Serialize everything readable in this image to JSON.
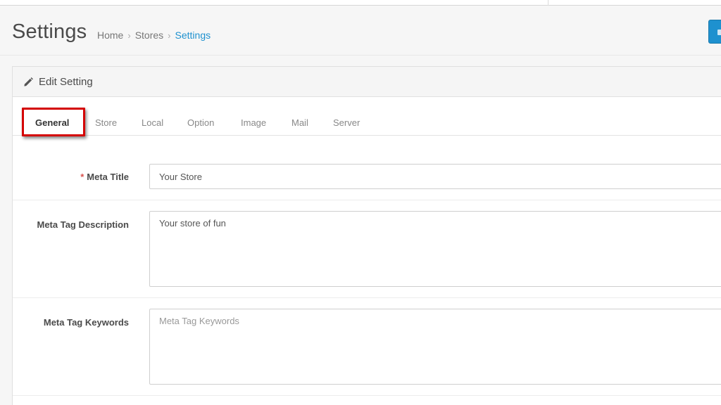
{
  "header": {
    "title": "Settings",
    "breadcrumb": [
      "Home",
      "Stores",
      "Settings"
    ]
  },
  "panel": {
    "title": "Edit Setting"
  },
  "tabs": [
    "General",
    "Store",
    "Local",
    "Option",
    "Image",
    "Mail",
    "Server"
  ],
  "active_tab": "General",
  "form": {
    "meta_title": {
      "required": "*",
      "label": "Meta Title",
      "value": "Your Store"
    },
    "meta_description": {
      "label": "Meta Tag Description",
      "value": "Your store of fun"
    },
    "meta_keywords": {
      "label": "Meta Tag Keywords",
      "value": "",
      "placeholder": "Meta Tag Keywords"
    }
  },
  "colors": {
    "accent": "#1e91cf",
    "required": "#d9534f",
    "highlight": "#d40000"
  }
}
